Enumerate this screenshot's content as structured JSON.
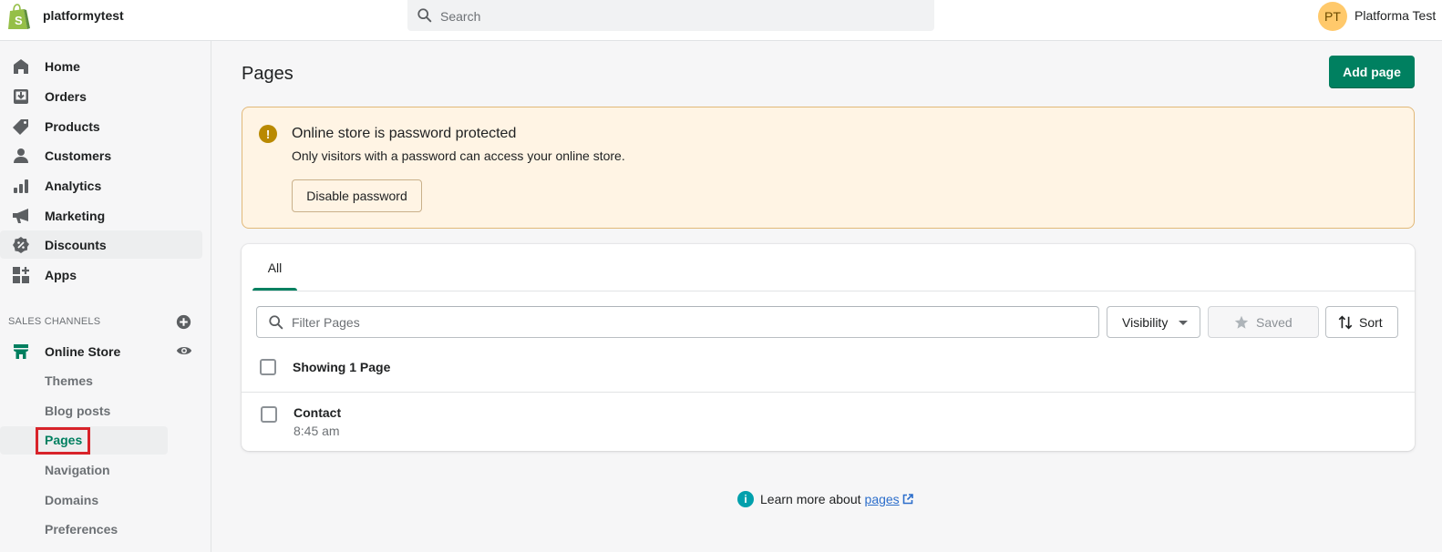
{
  "topbar": {
    "store_name": "platformytest",
    "search_placeholder": "Search",
    "user_initials": "PT",
    "user_name": "Platforma Test"
  },
  "sidebar": {
    "items": [
      {
        "label": "Home",
        "icon": "home-icon"
      },
      {
        "label": "Orders",
        "icon": "orders-icon"
      },
      {
        "label": "Products",
        "icon": "tag-icon"
      },
      {
        "label": "Customers",
        "icon": "person-icon"
      },
      {
        "label": "Analytics",
        "icon": "bar-chart-icon"
      },
      {
        "label": "Marketing",
        "icon": "megaphone-icon"
      },
      {
        "label": "Discounts",
        "icon": "discount-icon"
      },
      {
        "label": "Apps",
        "icon": "apps-icon"
      }
    ],
    "sales_channels_label": "SALES CHANNELS",
    "online_store": {
      "label": "Online Store",
      "sub_items": [
        {
          "label": "Themes"
        },
        {
          "label": "Blog posts"
        },
        {
          "label": "Pages",
          "active": true
        },
        {
          "label": "Navigation"
        },
        {
          "label": "Domains"
        },
        {
          "label": "Preferences"
        }
      ]
    }
  },
  "main": {
    "title": "Pages",
    "add_button": "Add page",
    "banner": {
      "title": "Online store is password protected",
      "text": "Only visitors with a password can access your online store.",
      "button": "Disable password"
    },
    "tabs": [
      {
        "label": "All",
        "selected": true
      }
    ],
    "filter_placeholder": "Filter Pages",
    "visibility_label": "Visibility",
    "saved_label": "Saved",
    "sort_label": "Sort",
    "showing_text": "Showing 1 Page",
    "rows": [
      {
        "title": "Contact",
        "time": "8:45 am"
      }
    ],
    "help": {
      "prefix": "Learn more about",
      "link": "pages"
    }
  },
  "colors": {
    "primary": "#008060",
    "banner_bg": "#fff4e4",
    "banner_border": "#e1b878",
    "warning_icon": "#b98900",
    "info_icon": "#00a0ac",
    "highlight": "#d8232a",
    "avatar": "#ffc96b"
  }
}
